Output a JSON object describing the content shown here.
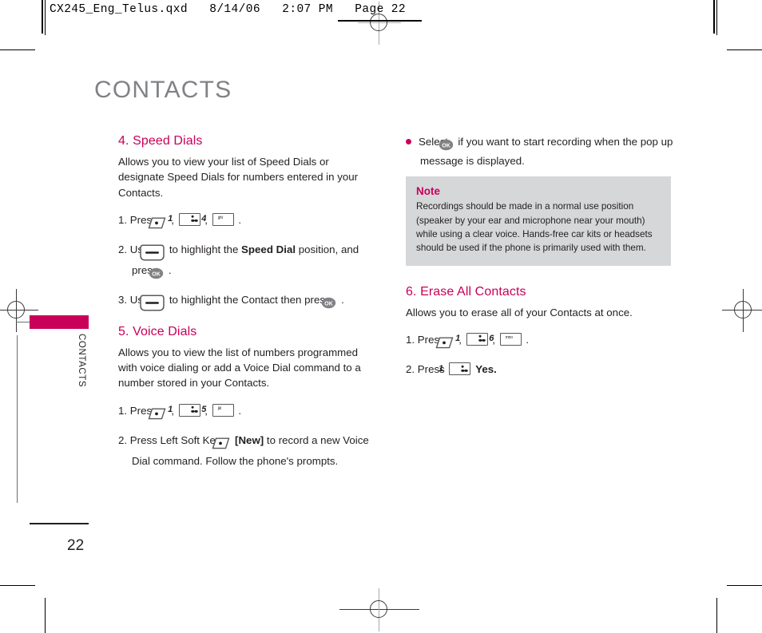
{
  "slug": {
    "text": "CX245_Eng_Telus.qxd   8/14/06   2:07 PM   Page 22"
  },
  "chapter": {
    "title": "CONTACTS",
    "side_label": "CONTACTS",
    "page_number": "22"
  },
  "colors": {
    "accent": "#c8005a",
    "title_gray": "#808285",
    "note_bg": "#d6d7d8",
    "text": "#231f20"
  },
  "left_column": {
    "speed_dials": {
      "heading": "4. Speed Dials",
      "intro": "Allows you to view your list of Speed Dials or designate Speed Dials for numbers entered in your Contacts.",
      "step1_a": "1. Press",
      "step1_comma1": ",",
      "step1_comma2": ",",
      "step1_period": ".",
      "step2_a": "2. Use",
      "step2_b": "to highlight the",
      "step2_bold": "Speed Dial",
      "step2_c": "position, and press",
      "step2_period": ".",
      "step3_a": "3. Use",
      "step3_b": "to highlight the Contact then press",
      "step3_period": "."
    },
    "voice_dials": {
      "heading": "5. Voice Dials",
      "intro": "Allows you to view the list of numbers programmed with voice dialing or add a Voice Dial command to a number stored in your Contacts.",
      "step1_a": "1. Press",
      "step1_comma1": ",",
      "step1_comma2": ",",
      "step1_period": ".",
      "step2_a": "2. Press Left Soft Key",
      "step2_bold": "[New]",
      "step2_b": "to record a new Voice Dial command. Follow the phone's prompts."
    }
  },
  "right_column": {
    "bullet": {
      "text_a": "Select",
      "text_b": "if you want to start recording when the pop up message is displayed."
    },
    "note": {
      "title": "Note",
      "body": "Recordings should be made in a normal use position (speaker by your ear and microphone near your mouth) while using a clear voice. Hands-free car kits or headsets should be used if the phone is primarily used with them."
    },
    "erase_all": {
      "heading": "6. Erase All Contacts",
      "intro": "Allows you to erase all of your Contacts at once.",
      "step1_a": "1. Press",
      "step1_comma1": ",",
      "step1_comma2": ",",
      "step1_period": ".",
      "step2_a": "2. Press",
      "step2_b": "Yes."
    }
  },
  "keys": {
    "soft_key": "left-soft-key",
    "nav_key": "navigation-key",
    "ok_key": "OK",
    "num1": {
      "digit": "1",
      "sub": ""
    },
    "num4": {
      "digit": "4",
      "sub": "ghi"
    },
    "num5": {
      "digit": "5",
      "sub": "jkl"
    },
    "num6": {
      "digit": "6",
      "sub": "mno"
    }
  }
}
